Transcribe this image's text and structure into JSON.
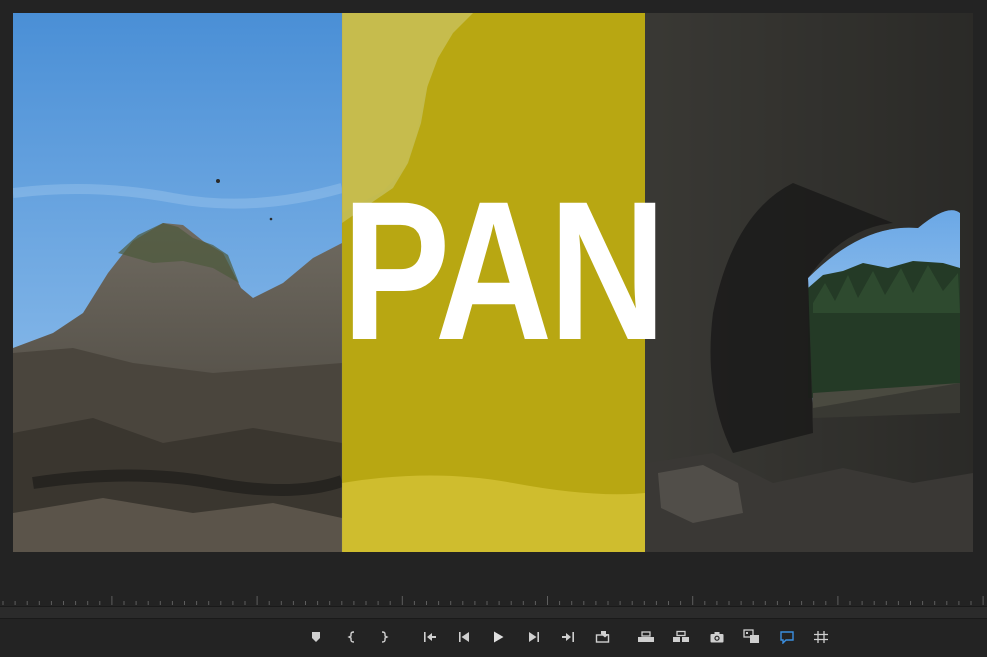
{
  "app": {
    "panel": "program-monitor"
  },
  "viewer": {
    "title_text": "PAN",
    "overlay_color": "#c4b208",
    "sky_color": "#5b9bd9"
  },
  "transport": {
    "accent_color": "#3b8fe0",
    "buttons": [
      {
        "name": "add-marker-button",
        "icon": "marker-icon"
      },
      {
        "name": "mark-in-button",
        "icon": "mark-in-icon"
      },
      {
        "name": "mark-out-button",
        "icon": "mark-out-icon"
      },
      {
        "name": "go-to-in-button",
        "icon": "go-to-in-icon"
      },
      {
        "name": "step-back-button",
        "icon": "step-back-icon"
      },
      {
        "name": "play-button",
        "icon": "play-icon"
      },
      {
        "name": "step-forward-button",
        "icon": "step-forward-icon"
      },
      {
        "name": "go-to-out-button",
        "icon": "go-to-out-icon"
      },
      {
        "name": "lift-button",
        "icon": "lift-icon"
      },
      {
        "name": "extract-button",
        "icon": "extract-icon"
      },
      {
        "name": "compare-button",
        "icon": "compare-icon"
      },
      {
        "name": "export-frame-button",
        "icon": "camera-icon"
      },
      {
        "name": "multi-camera-button",
        "icon": "multi-camera-icon"
      },
      {
        "name": "comparison-view-button",
        "icon": "speech-bubble-icon"
      },
      {
        "name": "safe-margins-button",
        "icon": "grid-icon"
      }
    ]
  }
}
